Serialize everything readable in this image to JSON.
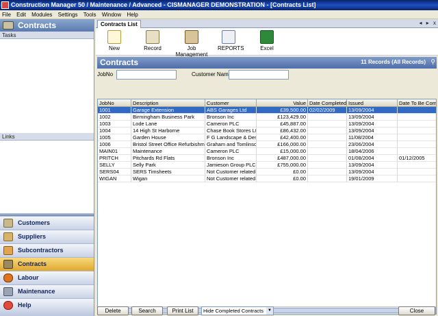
{
  "window": {
    "title": "Construction Manager 50 / Maintenance / Advanced  - CISMANAGER  DEMONSTRATION - [Contracts List]"
  },
  "menu": [
    "File",
    "Edit",
    "Modules",
    "Settings",
    "Tools",
    "Window",
    "Help"
  ],
  "left": {
    "header": "Contracts",
    "tasks_label": "Tasks",
    "links_label": "Links",
    "nav": [
      {
        "label": "Customers",
        "icon": "customers-icon"
      },
      {
        "label": "Suppliers",
        "icon": "suppliers-icon"
      },
      {
        "label": "Subcontractors",
        "icon": "subcontractors-icon"
      },
      {
        "label": "Contracts",
        "icon": "contracts-icon"
      },
      {
        "label": "Labour",
        "icon": "labour-icon"
      },
      {
        "label": "Maintenance",
        "icon": "maintenance-icon"
      },
      {
        "label": "Help",
        "icon": "help-icon"
      }
    ],
    "expand_glyph": "»"
  },
  "tab": {
    "label": "Contracts List",
    "controls": [
      "◂",
      "▸",
      "x"
    ]
  },
  "toolbar": {
    "new": "New",
    "record": "Record",
    "job_management": "Job Management",
    "reports": "REPORTS",
    "excel": "Excel"
  },
  "list": {
    "title": "Contracts",
    "count": "11 Records (All Records)",
    "filter_jobno_label": "JobNo",
    "filter_customer_label": "Customer Name",
    "columns": [
      "JobNo",
      "Description",
      "Customer",
      "Value",
      "Date Completed",
      "Issued",
      "Date To Be Comp"
    ],
    "rows": [
      [
        "1001",
        "Garage Extension",
        "ABS Garages Ltd",
        "£39,500.00",
        "02/02/2009",
        "13/09/2004",
        ""
      ],
      [
        "1002",
        "Birmingham Business Park",
        "Bronson Inc",
        "£123,429.00",
        "",
        "13/09/2004",
        ""
      ],
      [
        "1003",
        "Lode Lane",
        "Cameron PLC",
        "£45,887.00",
        "",
        "13/09/2004",
        ""
      ],
      [
        "1004",
        "14 High St Harborne",
        "Chase Book Stores Ltd",
        "£86,432.00",
        "",
        "13/09/2004",
        ""
      ],
      [
        "1005",
        "Garden House",
        "F G Landscape & Desi...",
        "£42,400.00",
        "",
        "11/08/2004",
        ""
      ],
      [
        "1006",
        "Bristol Street Office Refurbishment",
        "Graham and Tomlinso...",
        "£166,000.00",
        "",
        "23/06/2004",
        ""
      ],
      [
        "MAIN01",
        "Maintenance",
        "Cameron PLC",
        "£15,000.00",
        "",
        "18/04/2006",
        ""
      ],
      [
        "PRITCH",
        "Pitchards Rd Flats",
        "Bronson Inc",
        "£487,000.00",
        "",
        "01/08/2004",
        "01/12/2005"
      ],
      [
        "SELLY",
        "Selly Park",
        "Jamieson Group PLC",
        "£755,000.00",
        "",
        "13/09/2004",
        ""
      ],
      [
        "SERS04",
        "SERS Timsheets",
        "Not Customer related",
        "£0.00",
        "",
        "13/09/2004",
        ""
      ],
      [
        "WIGAN",
        "Wigan",
        "Not Customer related",
        "£0.00",
        "",
        "19/01/2009",
        ""
      ]
    ],
    "selected_row": 0
  },
  "footer": {
    "delete": "Delete",
    "search": "Search",
    "print_list": "Print List",
    "filter_select": "Hide Completed Contracts",
    "close": "Close"
  },
  "colors": {
    "selection": "#316ac5",
    "header_bar": "#4e6ea8",
    "titlebar": "#0a246a"
  }
}
